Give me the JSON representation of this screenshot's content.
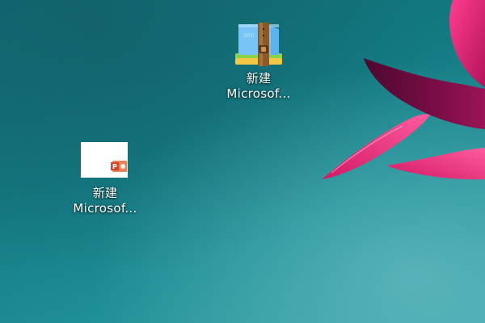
{
  "desktop": {
    "icons": [
      {
        "label_line1": "新建",
        "label_line2": "Microsof...",
        "icon": "zip-archive-icon"
      },
      {
        "label_line1": "新建",
        "label_line2": "Microsof...",
        "icon": "powerpoint-file-icon"
      }
    ]
  },
  "colors": {
    "wallpaper_teal": "#137a82",
    "flower_magenta": "#e0246e",
    "flower_dark": "#6a0a3c",
    "ppt_orange": "#d24726"
  }
}
